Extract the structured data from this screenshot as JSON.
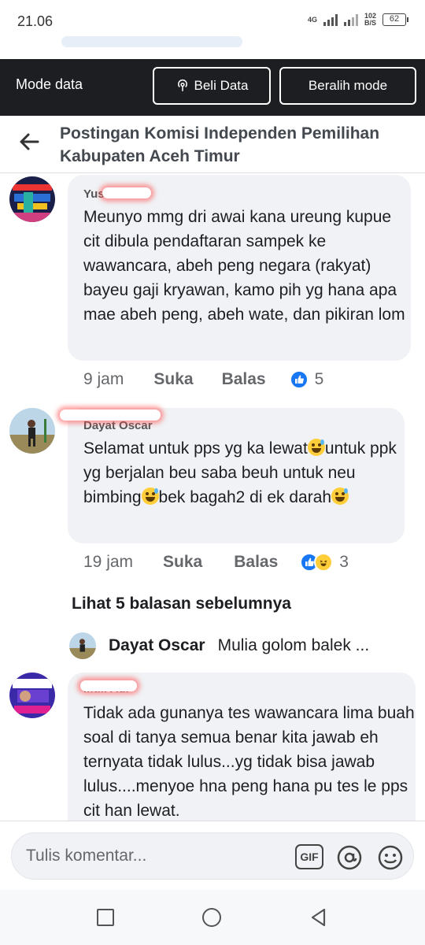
{
  "status_bar": {
    "time": "21.06",
    "network": "4G",
    "speed_value": "102",
    "speed_unit": "B/S",
    "battery": "62"
  },
  "data_mode_bar": {
    "title": "Mode data",
    "buy_button": "Beli Data",
    "switch_button": "Beralih mode"
  },
  "header": {
    "title": "Postingan Komisi Independen Pemilihan Kabupaten Aceh Timur"
  },
  "comments": [
    {
      "name": "Yus",
      "text": "Meunyo mmg dri awai kana ureung kupue cit dibula pendaftaran sampek ke wawancara, abeh peng negara (rakyat) bayeu gaji kryawan, kamo pih yg hana apa mae abeh peng, abeh wate, dan pikiran lom",
      "time": "9 jam",
      "like_label": "Suka",
      "reply_label": "Balas",
      "reaction_count": "5"
    },
    {
      "name": "Dayat Oscar",
      "text_parts": [
        "Selamat untuk pps yg ka lewat",
        "untuk ppk yg berjalan beu saba beuh untuk neu bimbing",
        "bek bagah2 di ek darah"
      ],
      "time": "19 jam",
      "like_label": "Suka",
      "reply_label": "Balas",
      "reaction_count": "3"
    },
    {
      "name": "Muli Adi",
      "text": "Tidak ada gunanya tes wawancara lima buah soal di tanya semua benar kita jawab eh ternyata tidak lulus...yg tidak bisa jawab lulus....menyoe hna peng hana pu tes le pps cit han lewat."
    }
  ],
  "view_previous": "Lihat 5 balasan sebelumnya",
  "reply_preview": {
    "name": "Dayat Oscar",
    "text": "Mulia golom balek ..."
  },
  "composer": {
    "placeholder": "Tulis komentar...",
    "gif_label": "GIF"
  },
  "colors": {
    "bubble": "#f0f2f5",
    "dark_bar": "#1c1e21",
    "like_blue": "#1877f2"
  }
}
